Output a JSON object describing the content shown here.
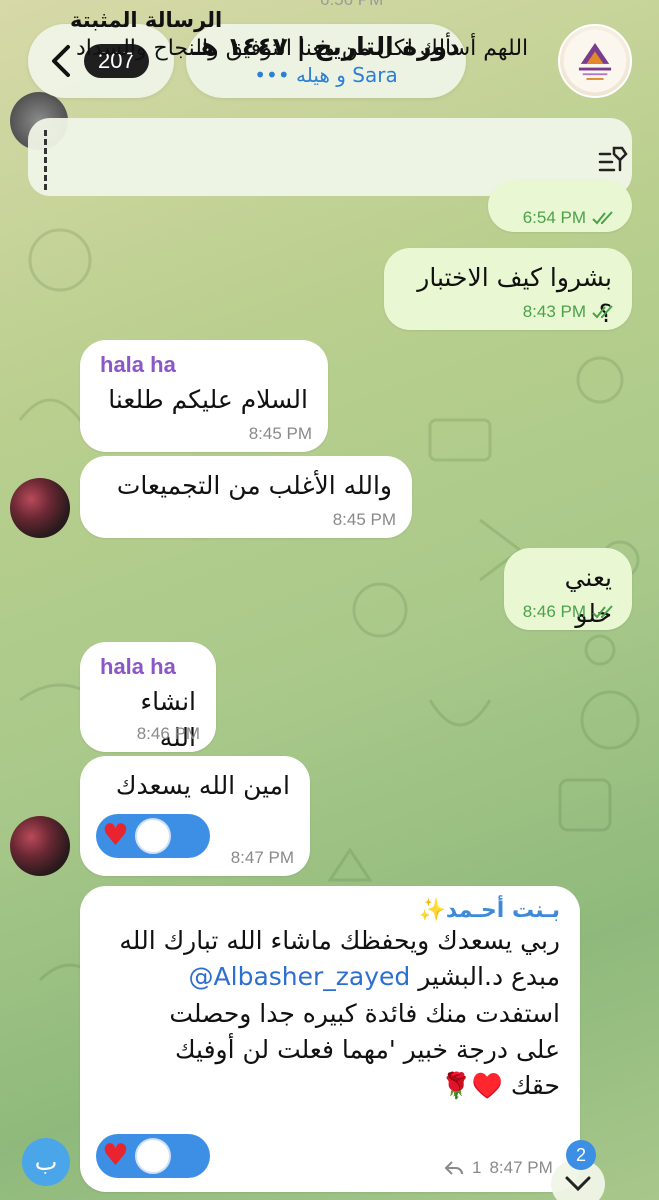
{
  "header": {
    "back_count": "207",
    "chat_title": "دورة التاريخ | ١٤٤٧ هـ",
    "chat_subtitle": "Sara و هيله •••"
  },
  "top_time_fragment": "6:56 PM",
  "pinned": {
    "title": "الرسالة المثبتة",
    "text": "اللهم أسألك لكل من معنا التوفيق والنجاح والسداد"
  },
  "messages": [
    {
      "type": "out",
      "text": "",
      "time": "6:54 PM"
    },
    {
      "type": "out",
      "text": "بشروا كيف الاختبار ؟",
      "time": "8:43 PM"
    },
    {
      "type": "in",
      "sender": "hala ha",
      "text": "السلام عليكم طلعنا",
      "time": "8:45 PM"
    },
    {
      "type": "in",
      "text": "والله الأغلب من التجميعات",
      "time": "8:45 PM"
    },
    {
      "type": "out",
      "text": "يعني حلو",
      "time": "8:46 PM"
    },
    {
      "type": "in",
      "sender": "hala ha",
      "text": "انشاء الله",
      "time": "8:46 PM"
    },
    {
      "type": "in",
      "text": "امين الله يسعدك",
      "time": "8:47 PM"
    },
    {
      "type": "in",
      "sender": "بـنت أحـمد✨",
      "line1": "ربي يسعدك ويحفظك ماشاء الله تبارك الله",
      "line2_prefix": "مبدع د.البشير ",
      "line2_link": "@Albasher_zayed",
      "line3": "استفدت منك فائدة كبيره جدا وحصلت",
      "line4": "على درجة خبير 'مهما فعلت لن أوفيك",
      "line5": "حقك ♥️🌹",
      "time": "8:47 PM",
      "forwards": "1"
    }
  ],
  "composer": {
    "button_label": "ب"
  },
  "scroll": {
    "badge": "2"
  },
  "colors": {
    "outgoing": "#eaf7d3",
    "incoming": "#ffffff",
    "accent": "#3d8fe6",
    "sender": "#8b57c8"
  }
}
